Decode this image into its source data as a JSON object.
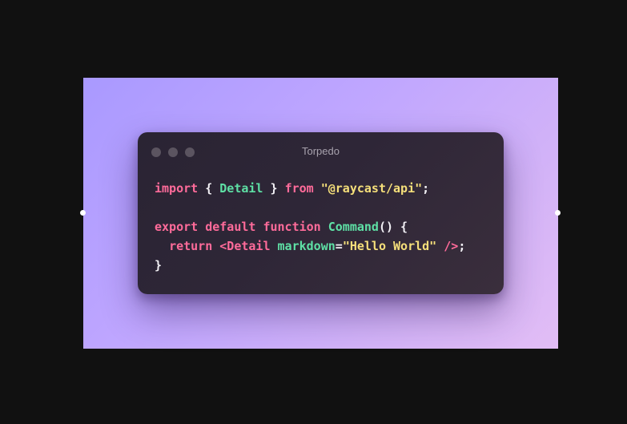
{
  "window": {
    "title": "Torpedo"
  },
  "colors": {
    "keyword": "#ff6b9a",
    "identifier": "#5ee0a5",
    "string": "#f5df7a",
    "punctuation": "#f2f0f5",
    "background": "#111111",
    "window_bg": "#2e2637"
  },
  "code": {
    "lines": [
      [
        {
          "t": "import",
          "k": "kw"
        },
        {
          "t": " { ",
          "k": "punc"
        },
        {
          "t": "Detail",
          "k": "id"
        },
        {
          "t": " } ",
          "k": "punc"
        },
        {
          "t": "from",
          "k": "kw"
        },
        {
          "t": " ",
          "k": "punc"
        },
        {
          "t": "\"@raycast/api\"",
          "k": "str"
        },
        {
          "t": ";",
          "k": "punc"
        }
      ],
      [],
      [
        {
          "t": "export",
          "k": "kw"
        },
        {
          "t": " ",
          "k": "punc"
        },
        {
          "t": "default",
          "k": "kw"
        },
        {
          "t": " ",
          "k": "punc"
        },
        {
          "t": "function",
          "k": "kw"
        },
        {
          "t": " ",
          "k": "punc"
        },
        {
          "t": "Command",
          "k": "id"
        },
        {
          "t": "() {",
          "k": "punc"
        }
      ],
      [
        {
          "t": "  ",
          "k": "punc"
        },
        {
          "t": "return",
          "k": "kw"
        },
        {
          "t": " ",
          "k": "punc"
        },
        {
          "t": "<Detail",
          "k": "tag"
        },
        {
          "t": " ",
          "k": "punc"
        },
        {
          "t": "markdown",
          "k": "id"
        },
        {
          "t": "=",
          "k": "punc"
        },
        {
          "t": "\"Hello World\"",
          "k": "str"
        },
        {
          "t": " ",
          "k": "punc"
        },
        {
          "t": "/>",
          "k": "tag"
        },
        {
          "t": ";",
          "k": "punc"
        }
      ],
      [
        {
          "t": "}",
          "k": "punc"
        }
      ]
    ]
  }
}
